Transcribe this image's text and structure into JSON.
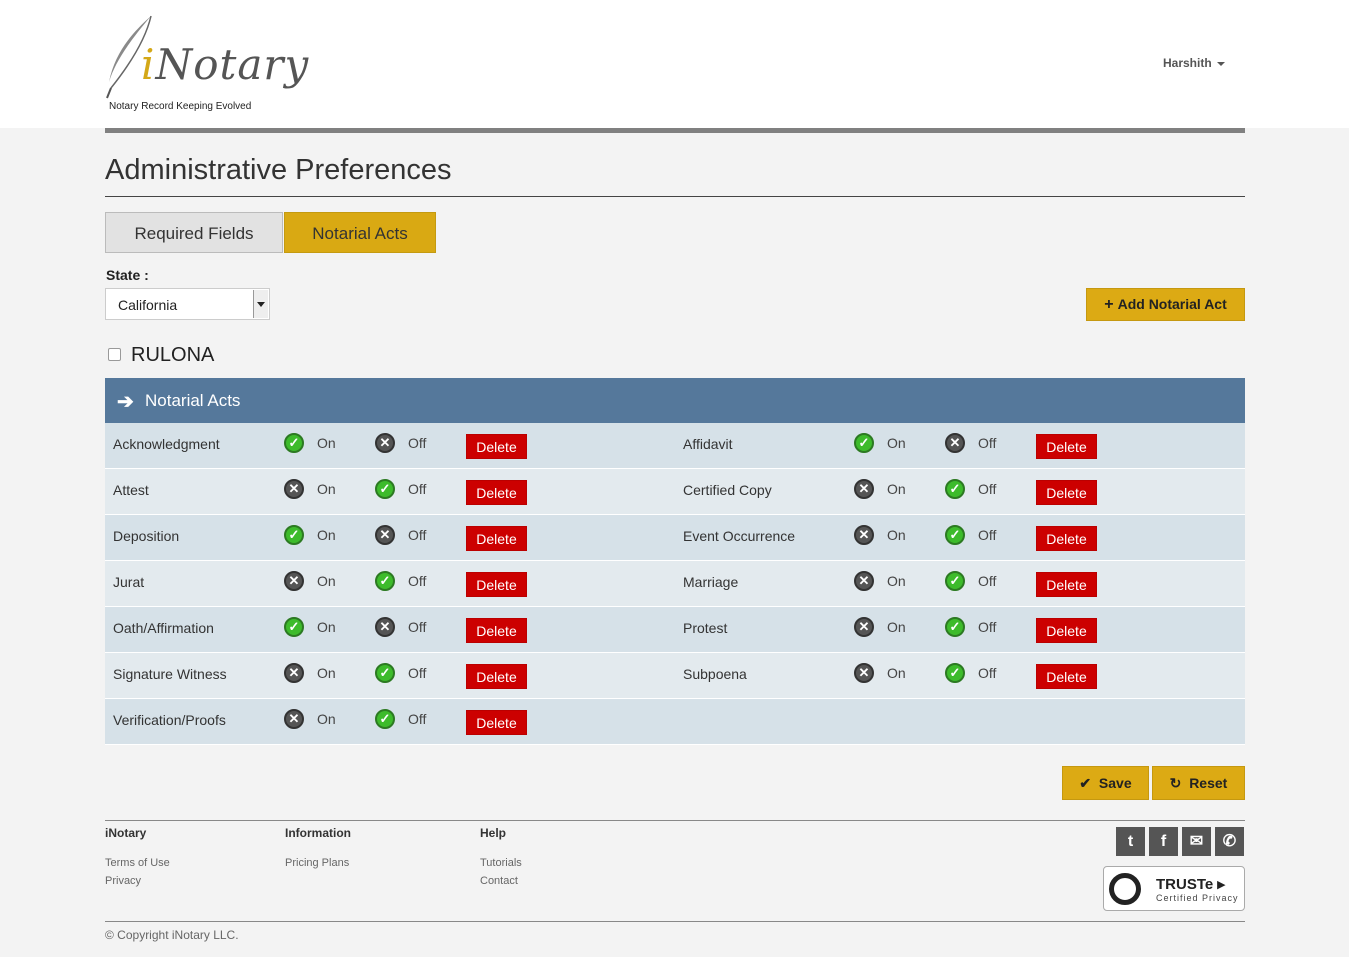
{
  "header": {
    "logo_text_i": "i",
    "logo_text_rest": "Notary",
    "logo_tagline": "Notary Record Keeping Evolved",
    "user_name": "Harshith"
  },
  "page": {
    "title": "Administrative Preferences",
    "tabs": [
      {
        "label": "Required Fields",
        "active": false
      },
      {
        "label": "Notarial Acts",
        "active": true
      }
    ]
  },
  "state": {
    "label": "State :",
    "selected": "California"
  },
  "add_button_label": "Add Notarial Act",
  "rulona_label": "RULONA",
  "rulona_checked": false,
  "panel": {
    "title": "Notarial Acts"
  },
  "labels": {
    "on": "On",
    "off": "Off",
    "delete": "Delete"
  },
  "acts": [
    {
      "name": "Acknowledgment",
      "enabled": true
    },
    {
      "name": "Affidavit",
      "enabled": true
    },
    {
      "name": "Attest",
      "enabled": false
    },
    {
      "name": "Certified Copy",
      "enabled": false
    },
    {
      "name": "Deposition",
      "enabled": true
    },
    {
      "name": "Event Occurrence",
      "enabled": false
    },
    {
      "name": "Jurat",
      "enabled": false
    },
    {
      "name": "Marriage",
      "enabled": false
    },
    {
      "name": "Oath/Affirmation",
      "enabled": true
    },
    {
      "name": "Protest",
      "enabled": false
    },
    {
      "name": "Signature Witness",
      "enabled": false
    },
    {
      "name": "Subpoena",
      "enabled": false
    },
    {
      "name": "Verification/Proofs",
      "enabled": false
    }
  ],
  "actions": {
    "save": "Save",
    "reset": "Reset"
  },
  "footer": {
    "columns": [
      {
        "heading": "iNotary",
        "links": [
          "Terms of Use",
          "Privacy"
        ]
      },
      {
        "heading": "Information",
        "links": [
          "Pricing Plans"
        ]
      },
      {
        "heading": "Help",
        "links": [
          "Tutorials",
          "Contact"
        ]
      }
    ],
    "social": [
      "twitter-icon",
      "facebook-icon",
      "email-icon",
      "phone-icon"
    ],
    "truste_name": "TRUSTe",
    "truste_sub": "Certified Privacy",
    "copyright": "© Copyright iNotary LLC."
  },
  "colors": {
    "accent": "#dcaa14",
    "panel": "#55789b",
    "delete": "#cc0000",
    "on_green": "#3dbb2b"
  }
}
